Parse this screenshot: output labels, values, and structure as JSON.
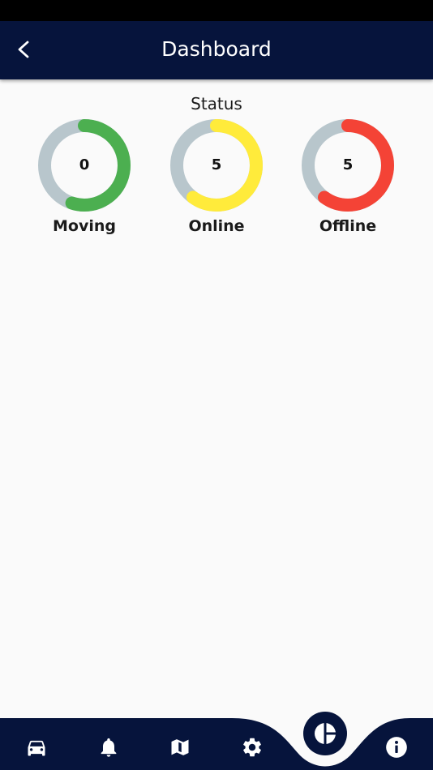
{
  "header": {
    "title": "Dashboard",
    "back_icon": "arrow-back-icon"
  },
  "status": {
    "title": "Status",
    "gauges": [
      {
        "label": "Moving",
        "value": "0",
        "fraction": 0.55,
        "color": "#4caf50"
      },
      {
        "label": "Online",
        "value": "5",
        "fraction": 0.6,
        "color": "#ffeb3b"
      },
      {
        "label": "Offline",
        "value": "5",
        "fraction": 0.6,
        "color": "#f44336"
      }
    ],
    "track_color": "#b8c6cc"
  },
  "bottom_nav": {
    "items": [
      {
        "icon": "car-icon"
      },
      {
        "icon": "bell-icon"
      },
      {
        "icon": "map-icon"
      },
      {
        "icon": "gear-icon"
      },
      {
        "icon": "pie-chart-icon",
        "active": true
      },
      {
        "icon": "info-icon"
      }
    ],
    "background_color": "#06143c"
  }
}
